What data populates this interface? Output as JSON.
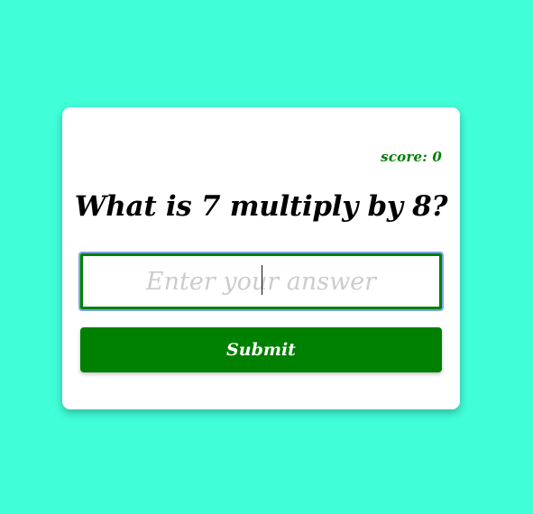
{
  "colors": {
    "page_background": "#40ffd8",
    "card_background": "#ffffff",
    "accent_green": "#008000",
    "focus_ring": "#7ea3e6",
    "placeholder": "#cccccc"
  },
  "quiz": {
    "score_text": "score: 0",
    "question_text": "What is 7 multiply by 8?",
    "answer": {
      "value": "",
      "placeholder": "Enter your answer"
    },
    "submit_label": "Submit"
  }
}
